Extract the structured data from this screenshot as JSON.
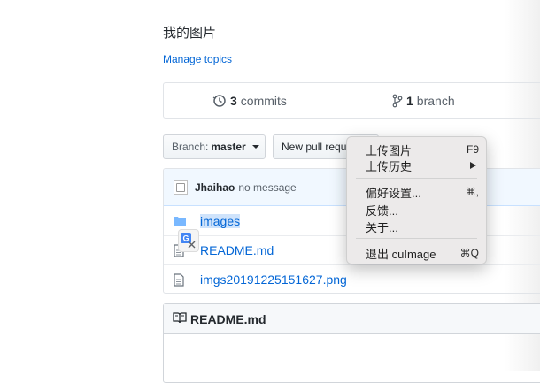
{
  "repo": {
    "description": "我的图片",
    "manage_topics": "Manage topics"
  },
  "stats": {
    "commits_count": "3",
    "commits_label": "commits",
    "branches_count": "1",
    "branches_label": "branch"
  },
  "toolbar": {
    "branch_label": "Branch:",
    "branch_value": "master",
    "new_pr_label": "New pull requ"
  },
  "commit": {
    "author": "Jhaihao",
    "message": "no message"
  },
  "files": [
    {
      "name": "images",
      "type": "folder-icon"
    },
    {
      "name": "README.md",
      "type": "file-icon"
    },
    {
      "name": "imgs20191225151627.png",
      "type": "file-icon"
    }
  ],
  "readme": {
    "title": "README.md"
  },
  "context_menu": {
    "items": [
      {
        "label": "上传图片",
        "shortcut": "F9"
      },
      {
        "label": "上传历史",
        "submenu": true
      },
      {
        "label": "偏好设置...",
        "shortcut": "⌘,"
      },
      {
        "label": "反馈..."
      },
      {
        "label": "关于..."
      },
      {
        "label": "退出 cuImage",
        "shortcut": "⌘Q"
      }
    ]
  }
}
